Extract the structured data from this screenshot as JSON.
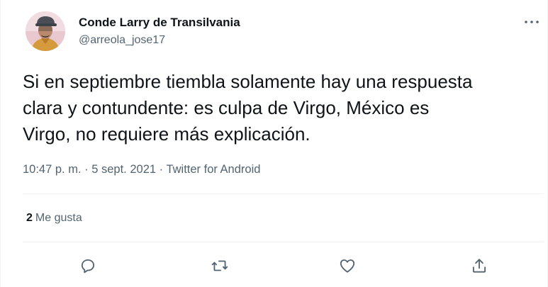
{
  "tweet": {
    "author": {
      "name": "Conde Larry de Transilvania",
      "handle": "@arreola_jose17",
      "avatar_icon": "profile-photo"
    },
    "text": "Si en septiembre tiembla solamente hay una respuesta\nclara y contundente: es culpa de Virgo, México es\nVirgo, no requiere más explicación.",
    "time": "10:47 p. m.",
    "date": "5 sept. 2021",
    "source": "Twitter for Android",
    "separator": " · ",
    "likes": {
      "count": "2",
      "label": "Me gusta"
    }
  },
  "actions": [
    {
      "name": "reply",
      "icon": "speech-bubble-icon"
    },
    {
      "name": "retweet",
      "icon": "retweet-arrows-icon"
    },
    {
      "name": "like",
      "icon": "heart-icon"
    },
    {
      "name": "share",
      "icon": "share-upload-icon"
    }
  ],
  "colors": {
    "text": "#0f1419",
    "secondary": "#536471",
    "divider": "#eff3f4",
    "background": "#ffffff"
  }
}
